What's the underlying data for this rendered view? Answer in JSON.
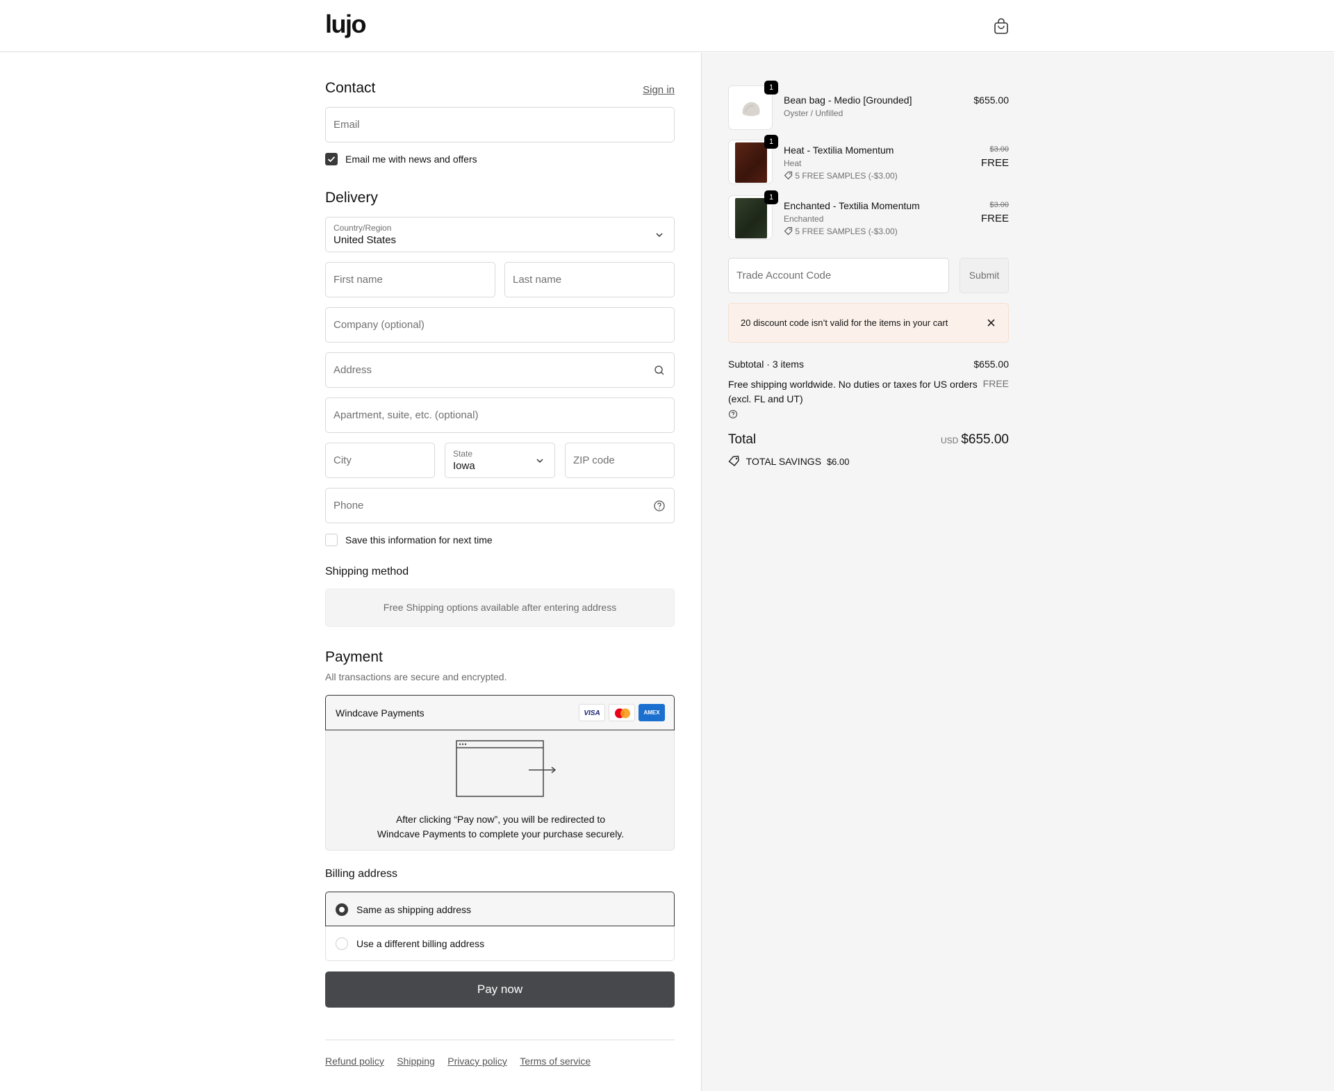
{
  "header": {
    "logo": "lujo",
    "cart_icon": "shopping-bag-icon"
  },
  "contact": {
    "title": "Contact",
    "sign_in": "Sign in",
    "email_placeholder": "Email",
    "news_label": "Email me with news and offers",
    "news_checked": true
  },
  "delivery": {
    "title": "Delivery",
    "country_label": "Country/Region",
    "country_value": "United States",
    "first_name": "First name",
    "last_name": "Last name",
    "company": "Company (optional)",
    "address": "Address",
    "apartment": "Apartment, suite, etc. (optional)",
    "city": "City",
    "state_label": "State",
    "state_value": "Iowa",
    "zip": "ZIP code",
    "phone": "Phone",
    "save_label": "Save this information for next time",
    "save_checked": false
  },
  "shipping": {
    "title": "Shipping method",
    "message": "Free Shipping options available after entering address"
  },
  "payment": {
    "title": "Payment",
    "subtitle": "All transactions are secure and encrypted.",
    "provider": "Windcave Payments",
    "cards": [
      "VISA",
      "Mastercard",
      "AMEX"
    ],
    "redirect_line1": "After clicking “Pay now”, you will be redirected to",
    "redirect_line2": "Windcave Payments to complete your purchase securely."
  },
  "billing": {
    "title": "Billing address",
    "options": [
      "Same as shipping address",
      "Use a different billing address"
    ],
    "selected": 0
  },
  "pay_button": "Pay now",
  "footer_links": [
    "Refund policy",
    "Shipping",
    "Privacy policy",
    "Terms of service"
  ],
  "order": {
    "items": [
      {
        "name": "Bean bag - Medio [Grounded]",
        "variant": "Oyster / Unfilled",
        "qty": "1",
        "price": "$655.00",
        "color": "#e7e4df"
      },
      {
        "name": "Heat - Textilia Momentum",
        "variant": "Heat",
        "discount": "5 FREE SAMPLES (-$3.00)",
        "qty": "1",
        "original_price": "$3.00",
        "price": "FREE",
        "color": "#4a1c12"
      },
      {
        "name": "Enchanted - Textilia Momentum",
        "variant": "Enchanted",
        "discount": "5 FREE SAMPLES (-$3.00)",
        "qty": "1",
        "original_price": "$3.00",
        "price": "FREE",
        "color": "#25301f"
      }
    ],
    "trade_code_placeholder": "Trade Account Code",
    "submit": "Submit",
    "alert": "20 discount code isn’t valid for the items in your cart",
    "subtotal_label": "Subtotal · 3 items",
    "subtotal_value": "$655.00",
    "shipping_text": "Free shipping worldwide. No duties or taxes for US orders (excl. FL and UT)",
    "shipping_value": "FREE",
    "total_label": "Total",
    "currency": "USD",
    "total_value": "$655.00",
    "savings_label": "TOTAL SAVINGS",
    "savings_value": "$6.00"
  }
}
